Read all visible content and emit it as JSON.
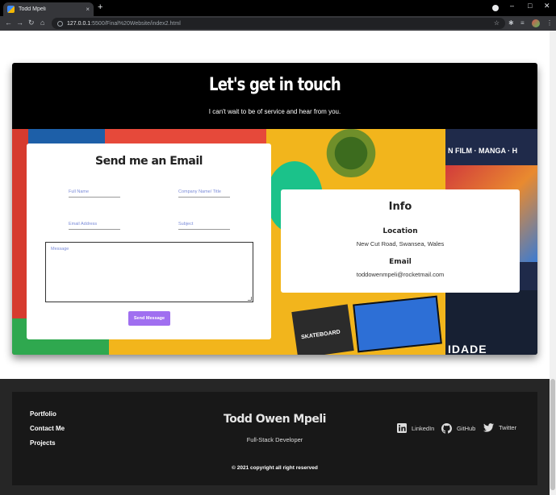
{
  "browser": {
    "tab_title": "Todd Mpeli",
    "tab_close": "×",
    "new_tab": "+",
    "url_host": "127.0.0.1",
    "url_rest": ":5500/Final%20Website/index2.html",
    "controls": {
      "minimize": "–",
      "maximize": "□",
      "close": "✕"
    }
  },
  "contact": {
    "title": "Let's get in touch",
    "subtitle": "I can't wait to be of service and hear from you.",
    "form": {
      "heading": "Send me an Email",
      "full_name_placeholder": "Full Name",
      "company_placeholder": "Company Name/ Title",
      "email_placeholder": "Email Address",
      "subject_placeholder": "Subject",
      "message_placeholder": "Message",
      "send_label": "Send Message"
    },
    "info": {
      "heading": "Info",
      "location_label": "Location",
      "location_value": "New Cut Road, Swansea, Wales",
      "email_label": "Email",
      "email_value": "toddowenmpeli@rocketmail.com"
    },
    "collage_text": {
      "poster": "N FILM · MANGA · H",
      "cards": "SKATEBOARD",
      "bottom": "IDADE"
    }
  },
  "footer": {
    "links": [
      "Portfolio",
      "Contact Me",
      "Projects"
    ],
    "name": "Todd Owen Mpeli",
    "role": "Full-Stack Developer",
    "social": {
      "linkedin": "LinkedIn",
      "github": "GitHub",
      "twitter": "Twitter"
    },
    "copyright": "© 2021 copyright all right reserved"
  },
  "colors": {
    "accent_button": "#a06ff0",
    "placeholder": "#7a8bd8",
    "footer_bg": "#181818",
    "collage_bg": "#f2b51c"
  }
}
